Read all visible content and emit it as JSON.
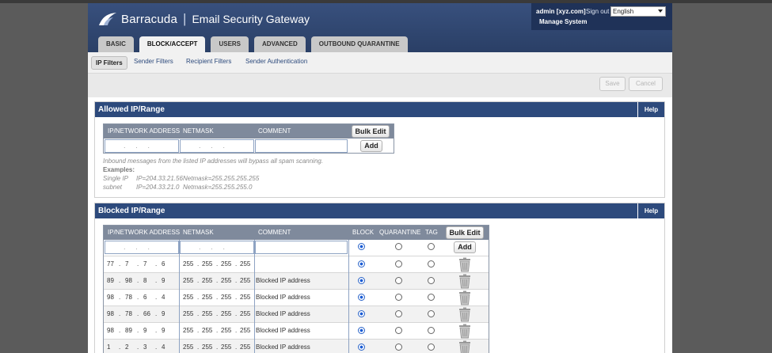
{
  "app": {
    "brand": "Barracuda",
    "product": "Email Security Gateway"
  },
  "account": {
    "user": "admin [xyz.com]",
    "signout": "Sign out",
    "language": "English",
    "manage": "Manage System"
  },
  "tabs": [
    {
      "label": "BASIC"
    },
    {
      "label": "BLOCK/ACCEPT"
    },
    {
      "label": "USERS"
    },
    {
      "label": "ADVANCED"
    },
    {
      "label": "OUTBOUND QUARANTINE"
    }
  ],
  "subnav": [
    {
      "label": "IP Filters"
    },
    {
      "label": "Sender Filters"
    },
    {
      "label": "Recipient Filters"
    },
    {
      "label": "Sender Authentication"
    }
  ],
  "toolbar": {
    "save": "Save",
    "cancel": "Cancel"
  },
  "allowed": {
    "title": "Allowed IP/Range",
    "help": "Help",
    "columns": {
      "ip": "IP/NETWORK ADDRESS",
      "mask": "NETMASK",
      "comment": "COMMENT"
    },
    "bulk_edit": "Bulk Edit",
    "add": "Add",
    "note": "Inbound messages from the listed IP addresses will bypass all spam scanning.",
    "examples_label": "Examples:",
    "examples": [
      {
        "name": "Single IP",
        "ip": "IP=204.33.21.56",
        "mask": "Netmask=255.255.255.255"
      },
      {
        "name": "subnet",
        "ip": "IP=204.33.21.0",
        "mask": "Netmask=255.255.255.0"
      }
    ]
  },
  "blocked": {
    "title": "Blocked IP/Range",
    "help": "Help",
    "columns": {
      "ip": "IP/NETWORK ADDRESS",
      "mask": "NETMASK",
      "comment": "COMMENT",
      "block": "BLOCK",
      "quarantine": "QUARANTINE",
      "tag": "TAG"
    },
    "bulk_edit": "Bulk Edit",
    "add": "Add",
    "rows": [
      {
        "ip": [
          "77",
          "7",
          "7",
          "6"
        ],
        "mask": [
          "255",
          "255",
          "255",
          "255"
        ],
        "comment": "",
        "action": "block"
      },
      {
        "ip": [
          "89",
          "98",
          "8",
          "9"
        ],
        "mask": [
          "255",
          "255",
          "255",
          "255"
        ],
        "comment": "Blocked IP address",
        "action": "block"
      },
      {
        "ip": [
          "98",
          "78",
          "6",
          "4"
        ],
        "mask": [
          "255",
          "255",
          "255",
          "255"
        ],
        "comment": "Blocked IP address",
        "action": "block"
      },
      {
        "ip": [
          "98",
          "78",
          "66",
          "9"
        ],
        "mask": [
          "255",
          "255",
          "255",
          "255"
        ],
        "comment": "Blocked IP address",
        "action": "block"
      },
      {
        "ip": [
          "98",
          "89",
          "9",
          "9"
        ],
        "mask": [
          "255",
          "255",
          "255",
          "255"
        ],
        "comment": "Blocked IP address",
        "action": "block"
      },
      {
        "ip": [
          "1",
          "2",
          "3",
          "4"
        ],
        "mask": [
          "255",
          "255",
          "255",
          "255"
        ],
        "comment": "Blocked IP address",
        "action": "block"
      }
    ]
  },
  "colors": {
    "header": "#2d4a7c",
    "table_head": "#7f8a9c",
    "accent": "#1a5cd6"
  }
}
